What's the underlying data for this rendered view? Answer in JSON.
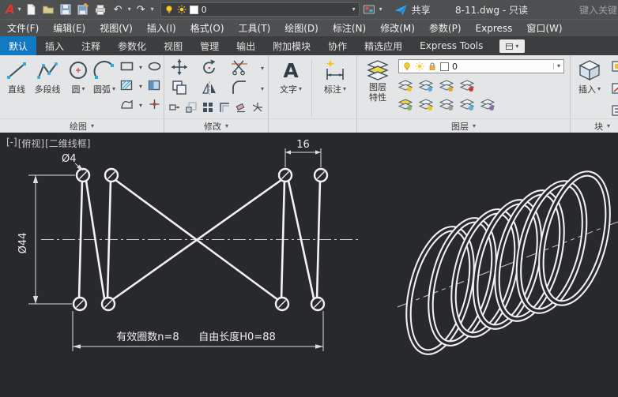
{
  "ui": {
    "caret_down": "▾",
    "caret_up": "▴",
    "undo_glyph": "↶",
    "redo_glyph": "↷"
  },
  "titlebar": {
    "logo_letter": "A",
    "window_title": "8-11.dwg - 只读",
    "share_label": "共享",
    "search_hint": "键入关键字",
    "layer_combo_value": "0"
  },
  "menubar": {
    "items": [
      "文件(F)",
      "编辑(E)",
      "视图(V)",
      "插入(I)",
      "格式(O)",
      "工具(T)",
      "绘图(D)",
      "标注(N)",
      "修改(M)",
      "参数(P)",
      "Express",
      "窗口(W)"
    ]
  },
  "ribbon": {
    "tabs": [
      "默认",
      "插入",
      "注释",
      "参数化",
      "视图",
      "管理",
      "输出",
      "附加模块",
      "协作",
      "精选应用",
      "Express Tools"
    ],
    "panels": {
      "draw": {
        "label": "绘图",
        "line": "直线",
        "polyline": "多段线",
        "circle": "圆",
        "arc": "圆弧"
      },
      "modify": {
        "label": "修改"
      },
      "annotate": {
        "text_glyph": "A",
        "text_label": "文字",
        "dim_label": "标注"
      },
      "layers": {
        "label": "图层",
        "props_line1": "图层",
        "props_line2": "特性",
        "combo_value": "0"
      },
      "block": {
        "label": "块",
        "insert_label": "插入"
      }
    }
  },
  "canvas": {
    "viewport_controls": {
      "collapse": "[-]",
      "view_name": "[俯视]",
      "visual_style": "[二维线框]"
    },
    "dims": {
      "wire_dia": "Ø4",
      "outer_dia": "Ø44",
      "pitch": "16",
      "coils": "有效圈数n=8",
      "free_length": "自由长度H0=88"
    }
  },
  "colors": {
    "accent_blue": "#1079c2",
    "share_blue": "#31a5f5",
    "canvas_bg": "#28292c",
    "drawing_white": "#f2f2f2",
    "icon_yellow": "#f8cc2f"
  }
}
